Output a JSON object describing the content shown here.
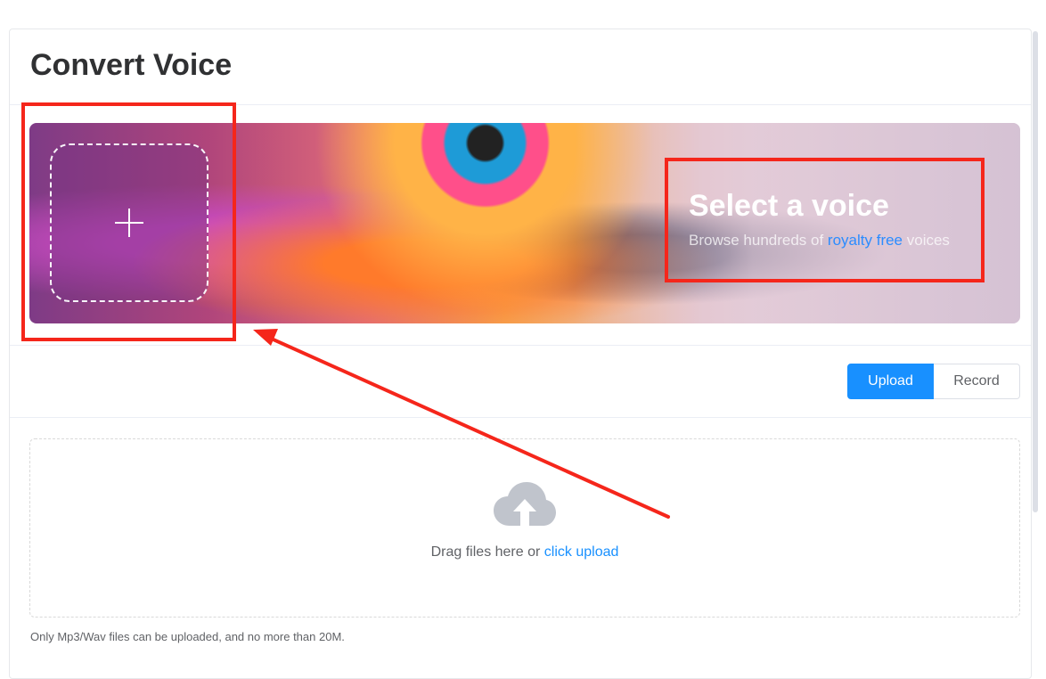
{
  "header": {
    "title": "Convert Voice"
  },
  "banner": {
    "add_icon": "plus-icon",
    "voice_title": "Select a voice",
    "voice_sub_before": "Browse hundreds of ",
    "voice_sub_link": "royalty free",
    "voice_sub_after": " voices"
  },
  "mode_tabs": {
    "upload_label": "Upload",
    "record_label": "Record",
    "active": "Upload"
  },
  "dropzone": {
    "icon": "cloud-upload-icon",
    "text": "Drag files here or ",
    "link": "click upload",
    "tip": "Only Mp3/Wav files can be uploaded, and no more than 20M."
  },
  "colors": {
    "accent": "#1890ff",
    "annotation": "#f5261b",
    "title": "#303133"
  }
}
